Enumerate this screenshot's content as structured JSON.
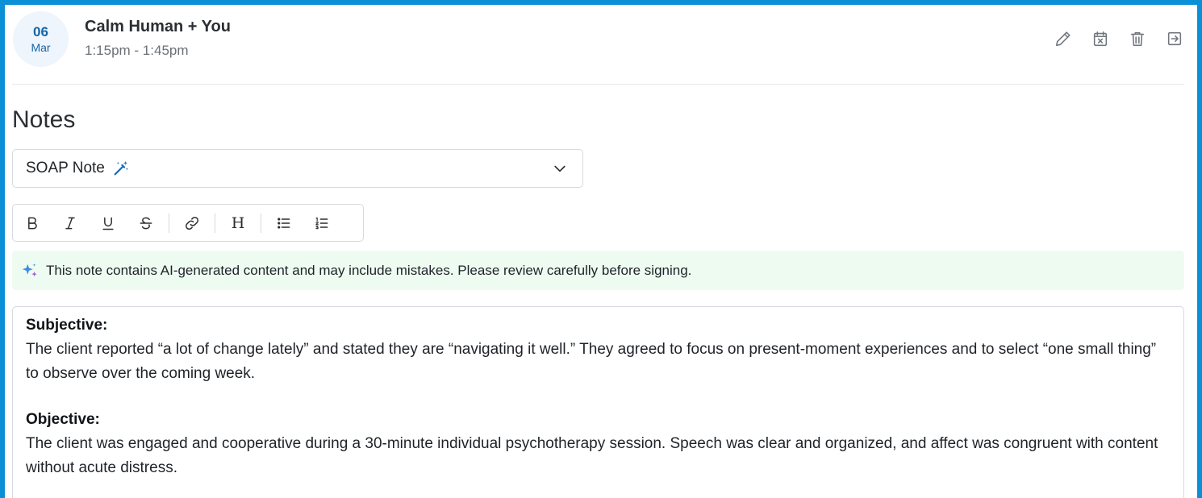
{
  "appointment": {
    "day": "06",
    "month": "Mar",
    "title": "Calm Human + You",
    "time": "1:15pm - 1:45pm"
  },
  "actions": [
    {
      "name": "edit-icon"
    },
    {
      "name": "cancel-appointment-icon"
    },
    {
      "name": "delete-icon"
    },
    {
      "name": "exit-icon"
    }
  ],
  "notes": {
    "heading": "Notes",
    "template_select": {
      "value": "SOAP Note",
      "icon": "magic-wand-icon"
    }
  },
  "toolbar": {
    "buttons": [
      "bold",
      "italic",
      "underline",
      "strikethrough",
      "link",
      "heading",
      "bullet-list",
      "numbered-list"
    ],
    "heading_glyph": "H"
  },
  "ai_banner": {
    "text": "This note contains AI-generated content and may include mistakes. Please review carefully before signing.",
    "icon": "sparkle-icon"
  },
  "editor": {
    "sections": [
      {
        "title": "Subjective:",
        "body": "The client reported “a lot of change lately” and stated they are “navigating it well.” They agreed to focus on present-moment experiences and to select “one small thing” to observe over the coming week."
      },
      {
        "title": "Objective:",
        "body": "The client was engaged and cooperative during a 30-minute individual psychotherapy session. Speech was clear and organized, and affect was congruent with content without acute distress."
      }
    ]
  },
  "colors": {
    "frame": "#0b8fd6",
    "accent": "#1565a7",
    "banner_bg": "#eefbf1"
  }
}
